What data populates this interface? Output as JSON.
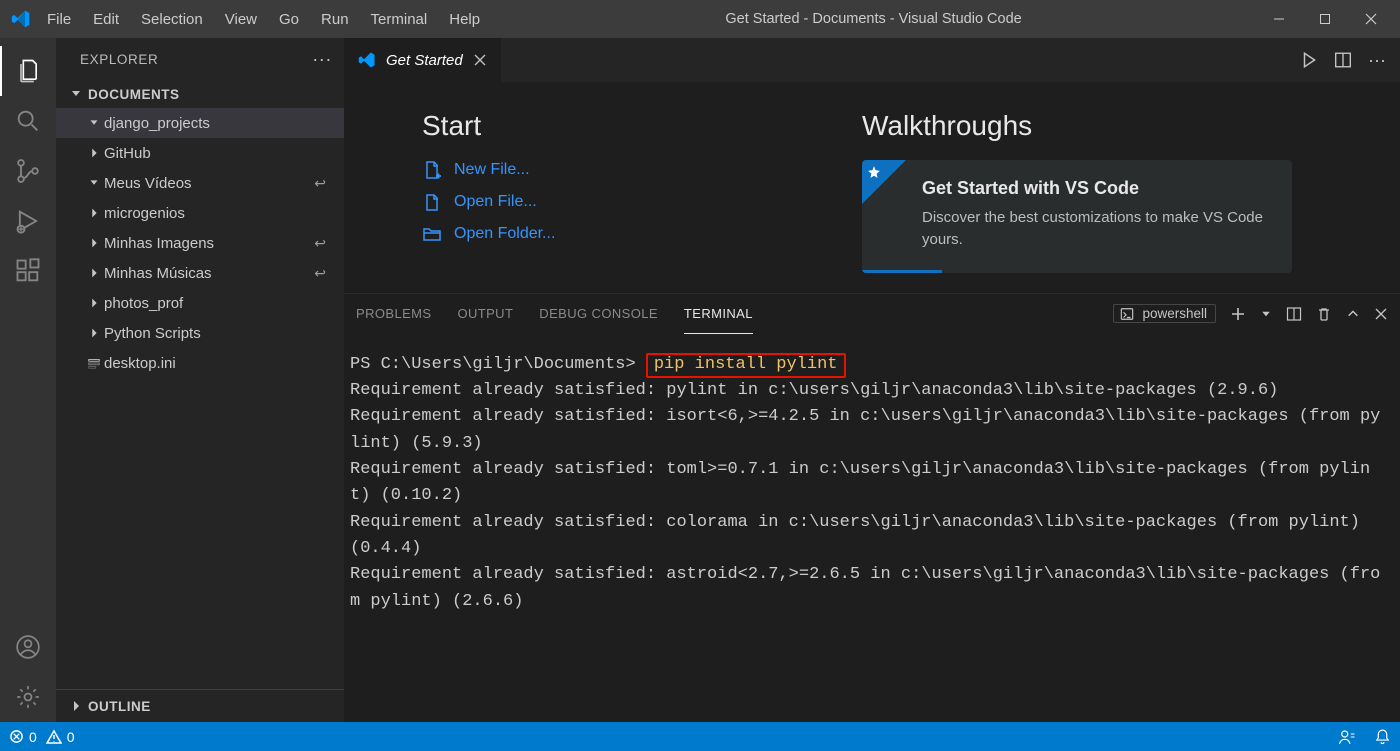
{
  "window": {
    "title": "Get Started - Documents - Visual Studio Code"
  },
  "menubar": [
    "File",
    "Edit",
    "Selection",
    "View",
    "Go",
    "Run",
    "Terminal",
    "Help"
  ],
  "sidebar": {
    "title": "EXPLORER",
    "root": "DOCUMENTS",
    "items": [
      {
        "label": "django_projects",
        "chevron": "down",
        "indent": 1,
        "selected": true
      },
      {
        "label": "GitHub",
        "chevron": "right",
        "indent": 1
      },
      {
        "label": "Meus Vídeos",
        "chevron": "down",
        "indent": 1,
        "link": true
      },
      {
        "label": "microgenios",
        "chevron": "right",
        "indent": 1
      },
      {
        "label": "Minhas Imagens",
        "chevron": "right",
        "indent": 1,
        "link": true
      },
      {
        "label": "Minhas Músicas",
        "chevron": "right",
        "indent": 1,
        "link": true
      },
      {
        "label": "photos_prof",
        "chevron": "right",
        "indent": 1
      },
      {
        "label": "Python Scripts",
        "chevron": "right",
        "indent": 1
      },
      {
        "label": "desktop.ini",
        "chevron": "file",
        "indent": 1
      }
    ],
    "outline": "OUTLINE"
  },
  "editor": {
    "tab_label": "Get Started",
    "start_heading": "Start",
    "links": {
      "new_file": "New File...",
      "open_file": "Open File...",
      "open_folder": "Open Folder..."
    },
    "walk_heading": "Walkthroughs",
    "walk_card": {
      "title": "Get Started with VS Code",
      "desc": "Discover the best customizations to make VS Code yours."
    }
  },
  "panel": {
    "tabs": {
      "problems": "PROBLEMS",
      "output": "OUTPUT",
      "debug": "DEBUG CONSOLE",
      "terminal": "TERMINAL"
    },
    "shell": "powershell",
    "prompt": "PS C:\\Users\\giljr\\Documents> ",
    "command": "pip install pylint",
    "output_lines": [
      "Requirement already satisfied: pylint in c:\\users\\giljr\\anaconda3\\lib\\site-packages (2.9.6)",
      "Requirement already satisfied: isort<6,>=4.2.5 in c:\\users\\giljr\\anaconda3\\lib\\site-packages (from pylint) (5.9.3)",
      "Requirement already satisfied: toml>=0.7.1 in c:\\users\\giljr\\anaconda3\\lib\\site-packages (from pylint) (0.10.2)",
      "Requirement already satisfied: colorama in c:\\users\\giljr\\anaconda3\\lib\\site-packages (from pylint) (0.4.4)",
      "Requirement already satisfied: astroid<2.7,>=2.6.5 in c:\\users\\giljr\\anaconda3\\lib\\site-packages (from pylint) (2.6.6)"
    ]
  },
  "statusbar": {
    "errors": "0",
    "warnings": "0"
  }
}
